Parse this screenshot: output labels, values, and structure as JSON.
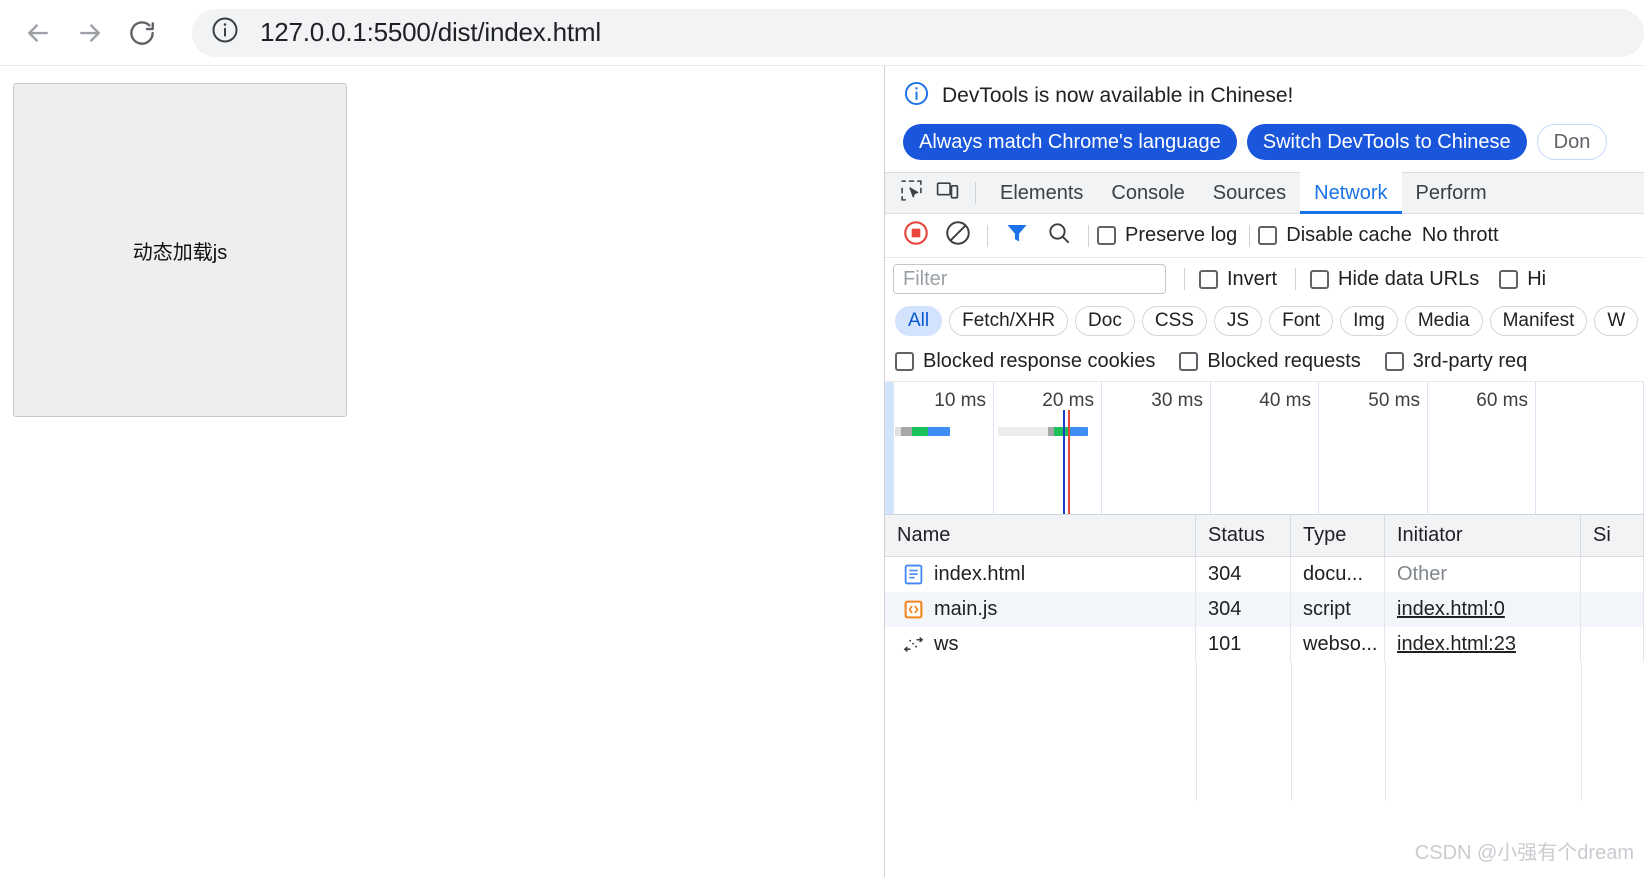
{
  "browser": {
    "back_icon": "arrow-left-icon",
    "forward_icon": "arrow-right-icon",
    "reload_icon": "reload-icon",
    "site_info_icon": "info-circle-icon",
    "url": "127.0.0.1:5500/dist/index.html"
  },
  "page": {
    "box_label": "动态加载js"
  },
  "devtools": {
    "banner": {
      "icon": "info-circle-icon",
      "message": "DevTools is now available in Chinese!",
      "buttons": [
        {
          "label": "Always match Chrome's language",
          "style": "primary"
        },
        {
          "label": "Switch DevTools to Chinese",
          "style": "primary"
        },
        {
          "label": "Don",
          "style": "secondary"
        }
      ]
    },
    "tabbar": {
      "inspect_icon": "inspect-cursor-icon",
      "device_icon": "device-toggle-icon",
      "tabs": [
        {
          "label": "Elements",
          "active": false
        },
        {
          "label": "Console",
          "active": false
        },
        {
          "label": "Sources",
          "active": false
        },
        {
          "label": "Network",
          "active": true
        },
        {
          "label": "Perform",
          "active": false
        }
      ]
    },
    "network_toolbar": {
      "record_icon": "record-stop-icon",
      "clear_icon": "clear-icon",
      "filter_icon": "filter-funnel-icon",
      "search_icon": "search-icon",
      "preserve_log": "Preserve log",
      "disable_cache": "Disable cache",
      "throttling": "No thrott"
    },
    "filter_row": {
      "placeholder": "Filter",
      "value": "",
      "invert": "Invert",
      "hide_data_urls": "Hide data URLs",
      "hide_extension_urls": "Hi"
    },
    "type_chips": [
      {
        "label": "All",
        "selected": true
      },
      {
        "label": "Fetch/XHR",
        "selected": false
      },
      {
        "label": "Doc",
        "selected": false
      },
      {
        "label": "CSS",
        "selected": false
      },
      {
        "label": "JS",
        "selected": false
      },
      {
        "label": "Font",
        "selected": false
      },
      {
        "label": "Img",
        "selected": false
      },
      {
        "label": "Media",
        "selected": false
      },
      {
        "label": "Manifest",
        "selected": false
      },
      {
        "label": "W",
        "selected": false
      }
    ],
    "blocked_row": {
      "blocked_response_cookies": "Blocked response cookies",
      "blocked_requests": "Blocked requests",
      "third_party_requests": "3rd-party req"
    },
    "timeline": {
      "ticks": [
        "10 ms",
        "20 ms",
        "30 ms",
        "40 ms",
        "50 ms",
        "60 ms"
      ],
      "dcl_line_color": "#1a3fc4",
      "load_line_color": "#e8453c",
      "bar_colors": {
        "queue": "#d8d8d8",
        "stall": "#a0a0a0",
        "wait": "#19c15b",
        "download": "#3f8ef7"
      }
    },
    "request_table": {
      "columns": [
        "Name",
        "Status",
        "Type",
        "Initiator",
        "Si"
      ],
      "rows": [
        {
          "icon": "document-icon",
          "name": "index.html",
          "status": "304",
          "type": "docu...",
          "initiator": "Other",
          "initiator_link": false,
          "size": ""
        },
        {
          "icon": "script-icon",
          "name": "main.js",
          "status": "304",
          "type": "script",
          "initiator": "index.html:0",
          "initiator_link": true,
          "size": ""
        },
        {
          "icon": "websocket-icon",
          "name": "ws",
          "status": "101",
          "type": "webso...",
          "initiator": "index.html:23",
          "initiator_link": true,
          "size": ""
        }
      ]
    },
    "watermark": "CSDN @小强有个dream"
  }
}
